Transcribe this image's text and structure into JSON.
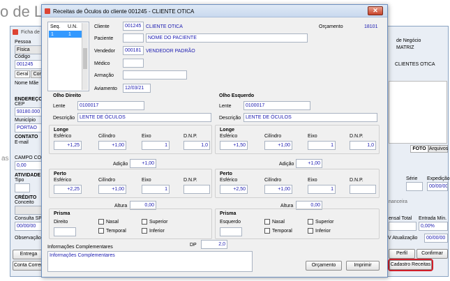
{
  "background": {
    "page_title": "o de L",
    "behind_window": {
      "title": "Ficha de",
      "labels": {
        "pessoa": "Pessoa",
        "codigo": "Código",
        "nome_mae": "Nome Mãe",
        "endereco": "ENDEREÇO",
        "cep": "CEP",
        "municipio": "Município",
        "contato": "CONTATO",
        "email": "E-mail",
        "campo_com": "CAMPO COM",
        "atividade": "ATIVIDADE",
        "tipo": "Tipo",
        "credito": "CRÉDITO",
        "conceito": "Conceito",
        "consulta_spc": "Consulta SPC",
        "observacao": "Observação"
      },
      "values": {
        "pessoa": "Física",
        "codigo": "001245",
        "cep": "93180.000",
        "municipio": "PORTAO",
        "campo_com": "0,00",
        "consulta_spc": "00/00/00"
      },
      "tabs": [
        "Geral",
        "Com"
      ],
      "buttons": {
        "entrega": "Entrega",
        "conta_corrente": "Conta Corren"
      },
      "side_text": "as"
    },
    "right_window": {
      "labels": {
        "tipo_negocio": "de Negócio",
        "matriz": "MATRIZ",
        "cliente": "CLIENTES OTICA",
        "serie": "Série",
        "expedicao": "Expedição",
        "financeira": "nanceira",
        "mensal_total": "ensal Total",
        "entrada_min": "Entrada Mín.",
        "atualizacao": "V Atualização"
      },
      "values": {
        "expedicao": "00/00/00",
        "entrada_min": "0,00%",
        "atualizacao": "00/00/00"
      },
      "tabs": {
        "foto": "FOTO",
        "arquivos": "Arquivos"
      },
      "buttons": {
        "perfil": "Perfil",
        "confirmar": "Confirmar",
        "cadastro_receitas": "Cadastro Receitas"
      }
    }
  },
  "dialog": {
    "title": "Receitas de Óculos do cliente 001245 - CLIENTE OTICA",
    "close_symbol": "✕",
    "list": {
      "headers": [
        "Seq.",
        "U.N."
      ],
      "rows": [
        [
          "1",
          "1"
        ]
      ]
    },
    "labels": {
      "cliente": "Cliente",
      "orcamento_num": "Orçamento",
      "paciente": "Paciente",
      "vendedor": "Vendedor",
      "medico": "Médico",
      "armacao": "Armação",
      "aviamento": "Aviamento"
    },
    "values": {
      "cliente_code": "001245",
      "cliente_name": "CLIENTE OTICA",
      "orcamento_num": "18101",
      "paciente": "NOME DO PACIENTE",
      "vendedor_code": "000181",
      "vendedor_name": "VENDEDOR PADRÃO",
      "aviamento": "12/03/21"
    },
    "right_eye": {
      "title": "Olho Direito",
      "lente_label": "Lente",
      "lente": "0100017",
      "descricao_label": "Descrição",
      "descricao": "LENTE DE ÓCULOS",
      "longe": {
        "title": "Longe",
        "esferico": "+1,25",
        "cilindro": "+1,00",
        "eixo": "1",
        "dnp": "1,0"
      },
      "adicao": "+1,00",
      "perto": {
        "title": "Perto",
        "esferico": "+2,25",
        "cilindro": "+1,00",
        "eixo": "1",
        "dnp": ""
      },
      "altura": "0,00",
      "prisma": {
        "title": "Prisma",
        "side_label": "Direito",
        "nasal": "Nasal",
        "superior": "Superior",
        "temporal": "Temporal",
        "inferior": "Inferior"
      }
    },
    "left_eye": {
      "title": "Olho Esquerdo",
      "lente_label": "Lente",
      "lente": "0100017",
      "descricao_label": "Descrição",
      "descricao": "LENTE DE ÓCULOS",
      "longe": {
        "title": "Longe",
        "esferico": "+1,50",
        "cilindro": "+1,00",
        "eixo": "1",
        "dnp": "1,0"
      },
      "adicao": "+1,00",
      "perto": {
        "title": "Perto",
        "esferico": "+2,50",
        "cilindro": "+1,00",
        "eixo": "1",
        "dnp": ""
      },
      "altura": "0,00",
      "prisma": {
        "title": "Prisma",
        "side_label": "Esquerdo",
        "nasal": "Nasal",
        "superior": "Superior",
        "temporal": "Temporal",
        "inferior": "Inferior"
      }
    },
    "column_labels": {
      "esferico": "Esférico",
      "cilindro": "Cilíndro",
      "eixo": "Eixo",
      "dnp": "D.N.P.",
      "adicao": "Adição",
      "altura": "Altura"
    },
    "info": {
      "label": "Informações Complementares",
      "text": "Informações Complementares"
    },
    "dp": {
      "label": "DP",
      "value": "2,0"
    },
    "buttons": {
      "orcamento": "Orçamento",
      "imprimir": "Imprimir"
    }
  },
  "colors": {
    "accent_text": "#1a1ab0",
    "highlight": "#d21f2a"
  }
}
